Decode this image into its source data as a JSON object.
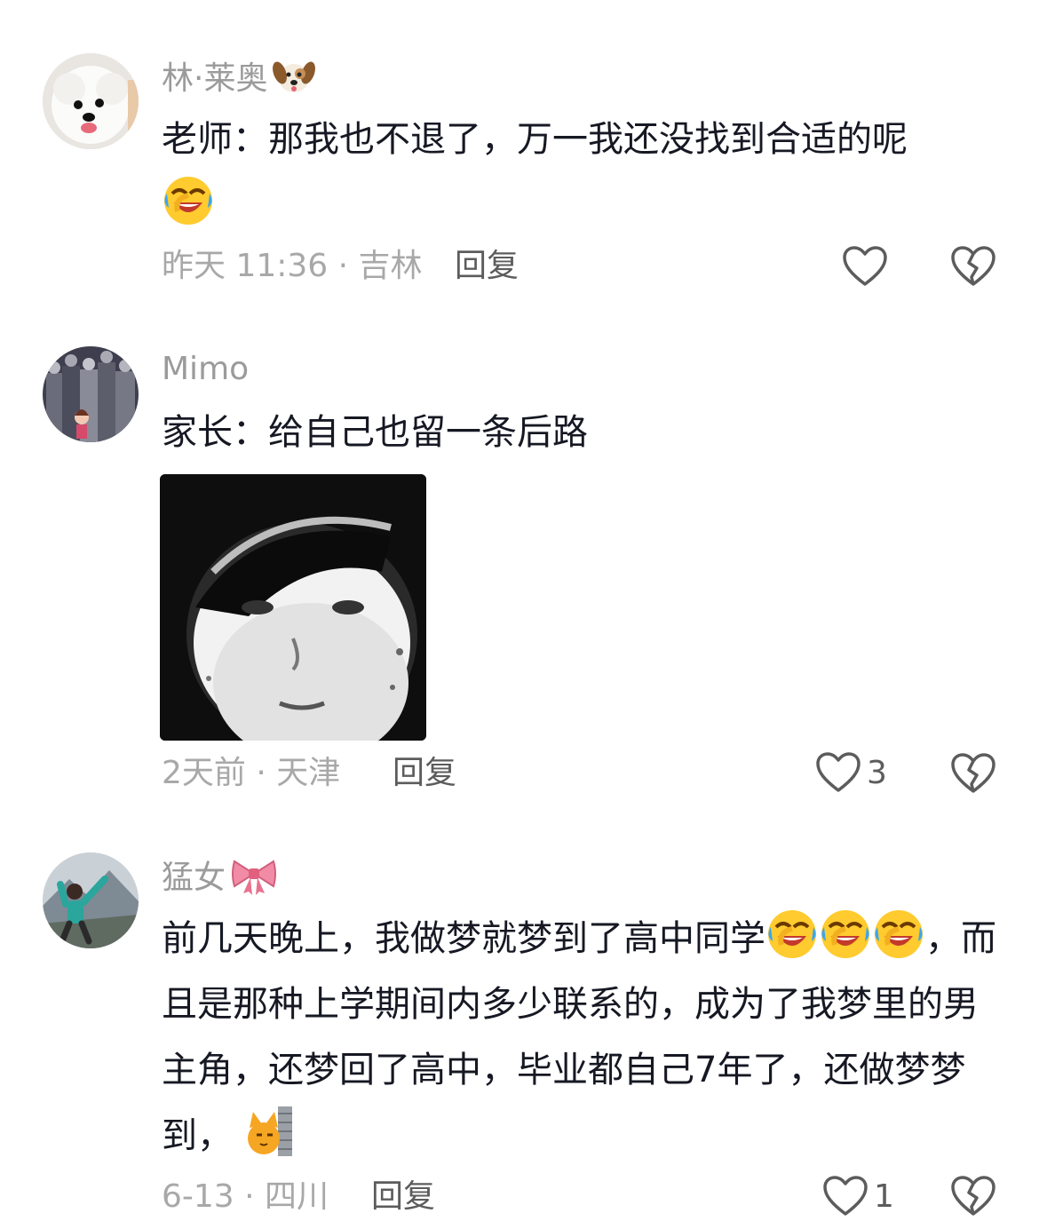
{
  "comments": [
    {
      "username": "林·莱奥",
      "username_badge": "dog-face-icon",
      "text_line1": "老师：那我也不退了，万一我还没找到合适的呢",
      "time_location": "昨天 11:36 · 吉林",
      "reply_label": "回复",
      "like_count": ""
    },
    {
      "username": "Mimo",
      "text_line1": "家长：给自己也留一条后路",
      "time_location": "2天前 · 天津",
      "reply_label": "回复",
      "like_count": "3"
    },
    {
      "username": "猛女",
      "username_badge": "ribbon-bow-icon",
      "text_part1": "前几天晚上，我做梦就梦到了高中同学",
      "text_part2": "，而且是那种上学期间内多少联系的，成为了我梦里的男主角，还梦回了高中，毕业都自己7年了，还做梦梦到，",
      "time_location": "6-13 · 四川",
      "reply_label": "回复",
      "like_count": "1"
    }
  ],
  "colors": {
    "username": "#9b9b9b",
    "text": "#161823",
    "meta": "#a8a8a8",
    "reply": "#5c5c5c",
    "icon_stroke": "#5c5c5c"
  },
  "icons": [
    "heart-outline-icon",
    "broken-heart-icon",
    "laughing-crying-emoji",
    "cat-peek-emoji"
  ]
}
